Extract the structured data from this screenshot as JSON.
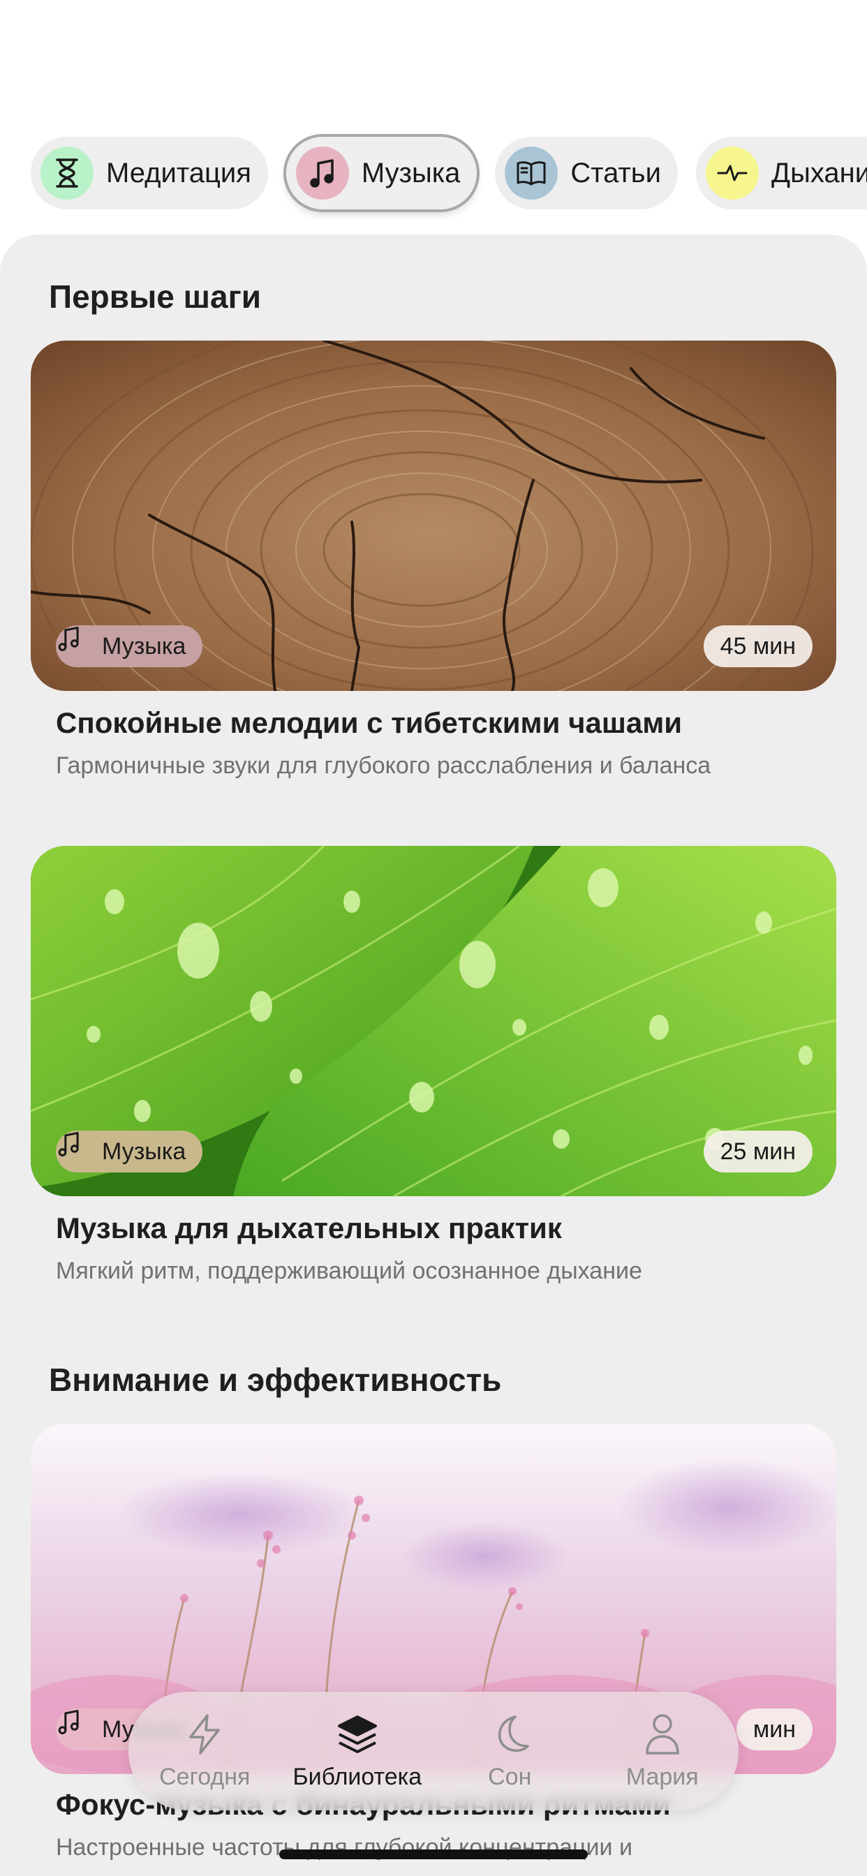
{
  "categories": [
    {
      "label": "Медитация",
      "icon": "hourglass-icon",
      "color": "#b9f2c8"
    },
    {
      "label": "Музыка",
      "icon": "music-note-icon",
      "color": "#e7b3c0",
      "active": true
    },
    {
      "label": "Статьи",
      "icon": "book-icon",
      "color": "#a9c5d5"
    },
    {
      "label": "Дыхание",
      "icon": "pulse-icon",
      "color": "#f6f58e"
    }
  ],
  "sections": [
    {
      "title": "Первые шаги",
      "cards": [
        {
          "tag": "Музыка",
          "tag_color": "#c6a1a3",
          "duration": "45 мин",
          "title": "Спокойные мелодии с тибетскими чашами",
          "description": "Гармоничные звуки для глубокого расслабления и баланса",
          "image": "wood-texture"
        },
        {
          "tag": "Музыка",
          "tag_color": "#c8b88c",
          "duration": "25 мин",
          "title": "Музыка для дыхательных практик",
          "description": "Мягкий ритм, поддерживающий осознанное дыхание",
          "image": "green-leaves-with-droplets"
        }
      ]
    },
    {
      "title": "Внимание и эффективность",
      "cards": [
        {
          "tag": "Музыка",
          "tag_color": "#e8b7c8",
          "duration": "мин",
          "title": "Фокус-музыка с бинауральными ритмами",
          "description": "Настроенные частоты для глубокой концентрации и",
          "image": "pink-grass-field"
        }
      ]
    }
  ],
  "nav": [
    {
      "label": "Сегодня",
      "icon": "lightning-icon"
    },
    {
      "label": "Библиотека",
      "icon": "layers-icon",
      "active": true
    },
    {
      "label": "Сон",
      "icon": "moon-icon"
    },
    {
      "label": "Мария",
      "icon": "user-icon"
    }
  ]
}
